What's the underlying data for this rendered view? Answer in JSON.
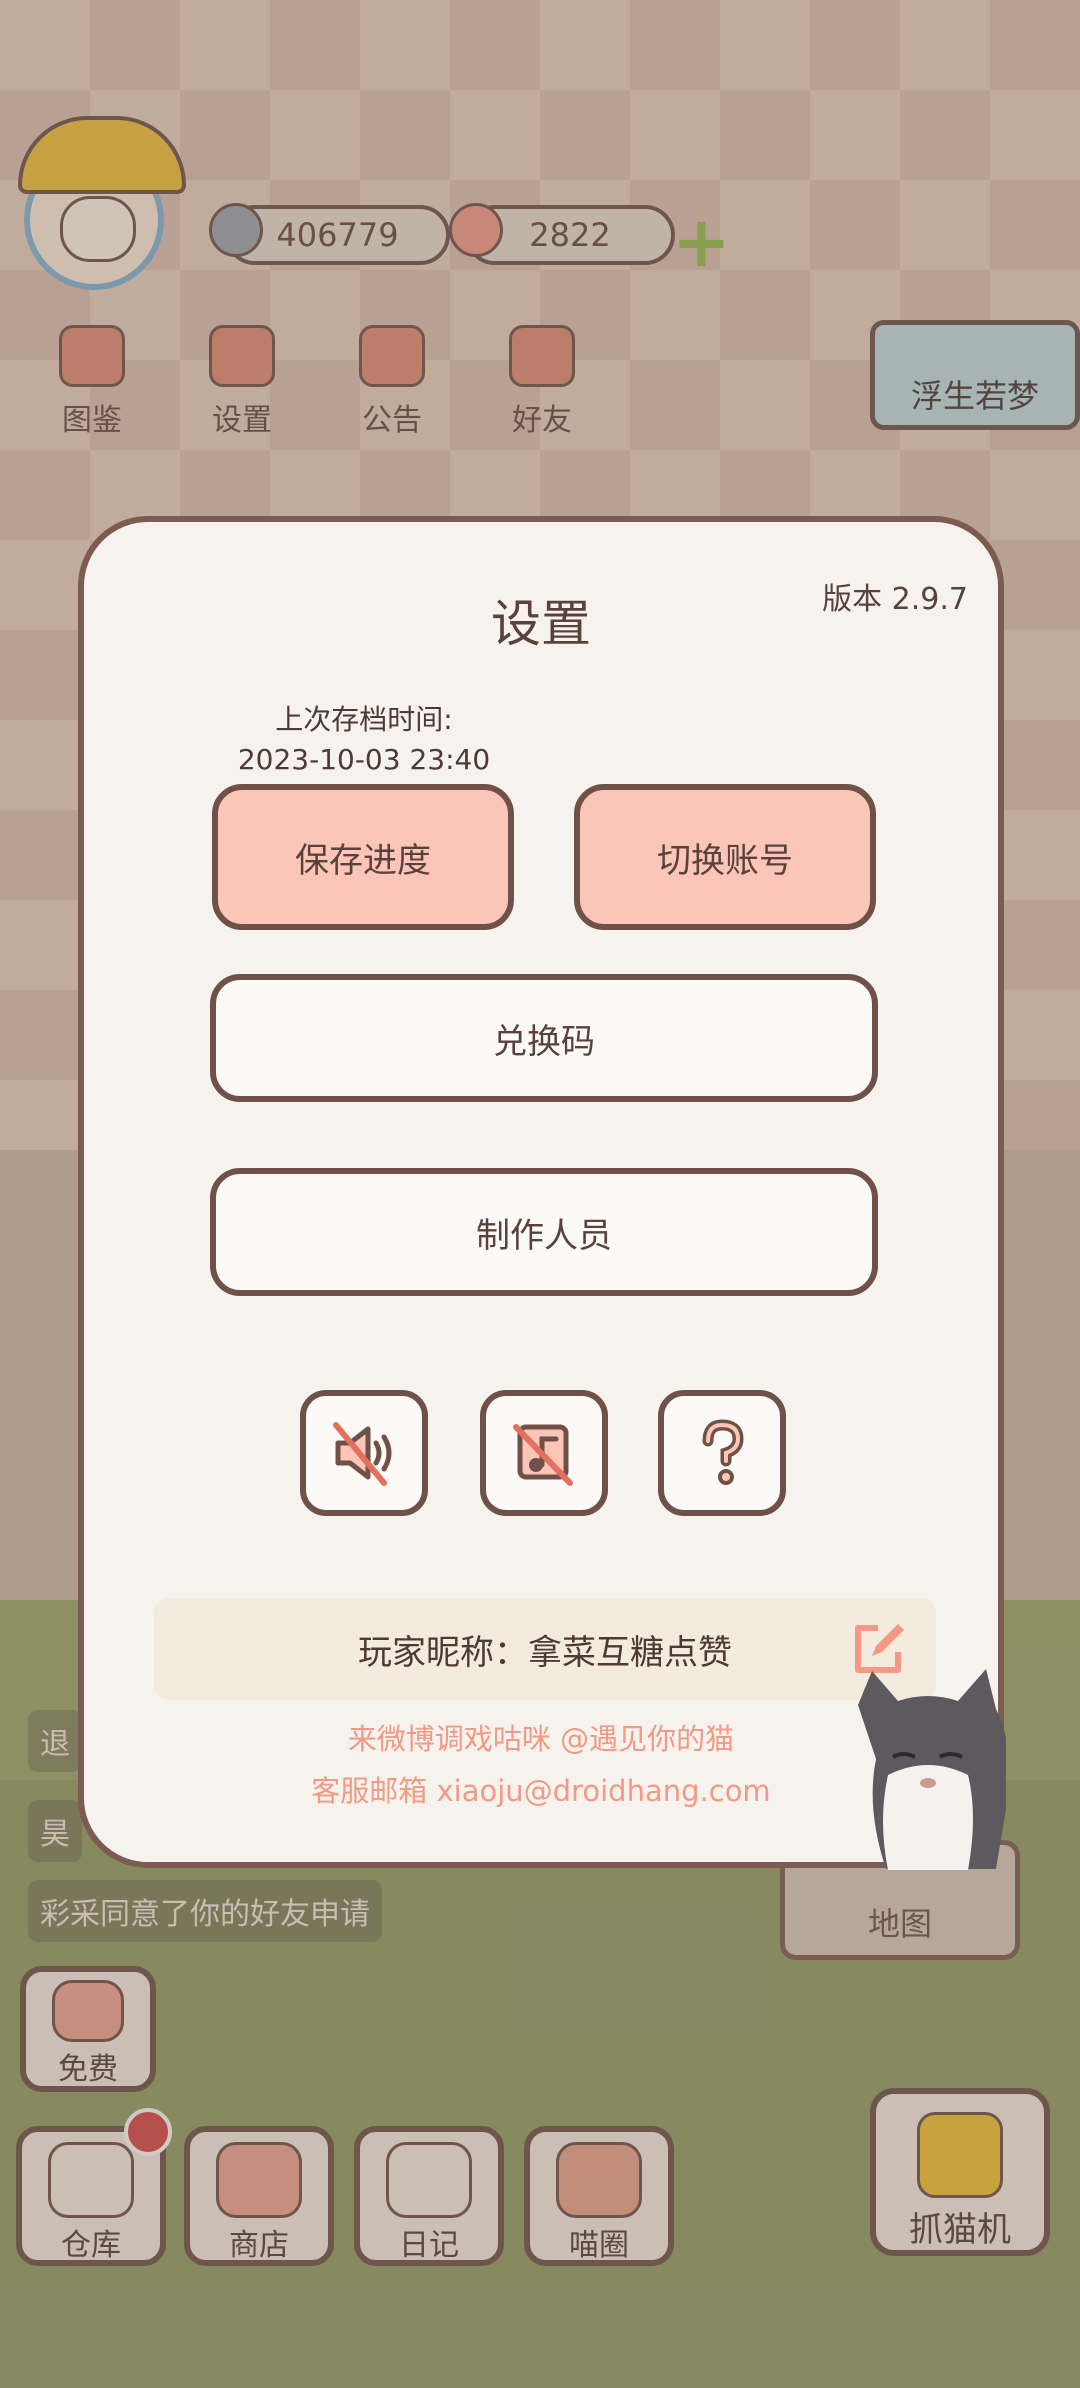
{
  "hud": {
    "coins": "406779",
    "hearts": "2822",
    "buttons": [
      "图鉴",
      "设置",
      "公告",
      "好友"
    ],
    "scene_sign": "浮生若梦"
  },
  "chat": {
    "messages": [
      "退",
      "昊",
      "彩采同意了你的好友申请"
    ]
  },
  "map_label": "地图",
  "bottom": {
    "free": "免费",
    "items": [
      "仓库",
      "商店",
      "日记",
      "喵圈"
    ],
    "claw": "抓猫机"
  },
  "settings": {
    "title": "设置",
    "version": "版本 2.9.7",
    "last_save_label": "上次存档时间:",
    "last_save_time": "2023-10-03 23:40",
    "save_button": "保存进度",
    "switch_account_button": "切换账号",
    "redeem_button": "兑换码",
    "credits_button": "制作人员",
    "icons": [
      "sound-off-icon",
      "music-off-icon",
      "help-icon"
    ],
    "nickname": "玩家昵称：拿菜互糖点赞",
    "weibo": "来微博调戏咕咪 @遇见你的猫",
    "email": "客服邮箱 xiaoju@droidhang.com"
  },
  "colors": {
    "pink_button": "#fbc5b7",
    "border_brown": "#6f5148",
    "link_salmon": "#f29a85",
    "modal_bg": "#f6f3ee"
  }
}
